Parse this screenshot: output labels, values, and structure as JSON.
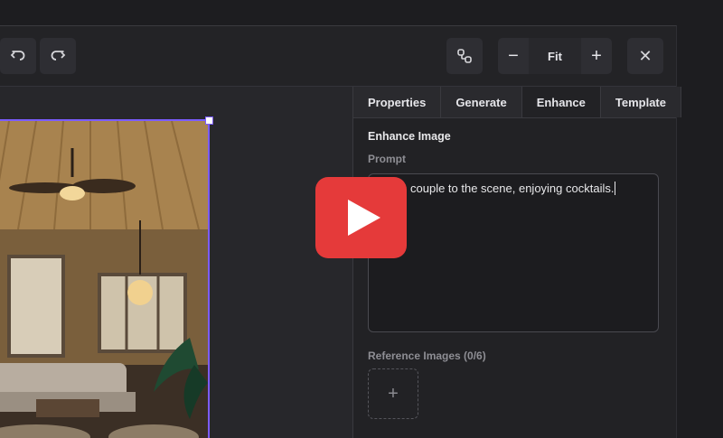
{
  "toolbar": {
    "undo_icon": "undo-icon",
    "redo_icon": "redo-icon",
    "link_icon": "link-icon",
    "zoom": {
      "minus": "−",
      "value": "Fit",
      "plus": "+"
    },
    "close": "✕"
  },
  "panel": {
    "tabs": [
      {
        "label": "Properties"
      },
      {
        "label": "Generate"
      },
      {
        "label": "Enhance"
      },
      {
        "label": "Template"
      }
    ],
    "active_tab": "Enhance",
    "section_title": "Enhance Image",
    "prompt_label": "Prompt",
    "prompt_value": "couple to the scene, enjoying cocktails.",
    "reference_label": "Reference Images (0/6)",
    "add_reference": "+"
  },
  "overlay": {
    "play_icon": "play-icon",
    "accent": "#e53a3a"
  },
  "colors": {
    "selection": "#7b5cff"
  }
}
